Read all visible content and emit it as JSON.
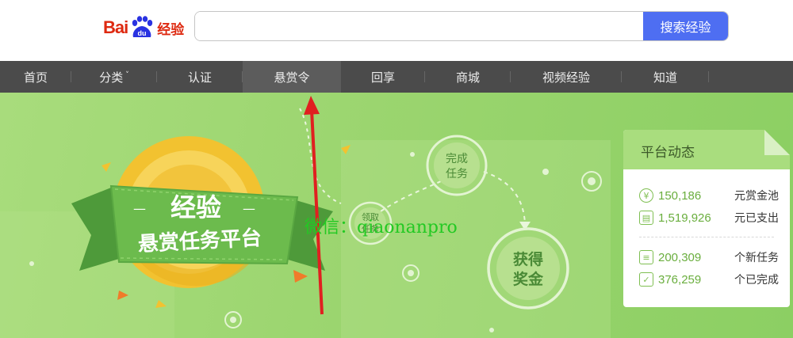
{
  "logo": {
    "bai": "Bai",
    "du": "du",
    "suffix": "经验"
  },
  "search": {
    "value": "",
    "placeholder": "",
    "button_label": "搜索经验"
  },
  "nav": {
    "items": [
      {
        "label": "首页"
      },
      {
        "label": "分类",
        "caret": "˅"
      },
      {
        "label": "认证"
      },
      {
        "label": "悬赏令",
        "active": true
      },
      {
        "label": "回享"
      },
      {
        "label": "商城"
      },
      {
        "label": "视频经验"
      },
      {
        "label": "知道"
      }
    ]
  },
  "banner": {
    "ribbon_line1": "经验",
    "ribbon_line2": "悬赏任务平台",
    "step_receive": "领取任务",
    "step_complete": "完成任务",
    "step_reward": "获得奖金",
    "step_receive_l1": "领取",
    "step_receive_l2": "任务",
    "step_complete_l1": "完成",
    "step_complete_l2": "任务",
    "step_reward_l1": "获得",
    "step_reward_l2": "奖金"
  },
  "watermark": "微信：qiaonanpro",
  "panel": {
    "title": "平台动态",
    "stats": [
      {
        "icon": "yen-icon",
        "value": "150,186",
        "unit": "元赏金池"
      },
      {
        "icon": "wallet-icon",
        "value": "1,519,926",
        "unit": "元已支出"
      },
      {
        "icon": "list-icon",
        "value": "200,309",
        "unit": "个新任务"
      },
      {
        "icon": "check-icon",
        "value": "376,259",
        "unit": "个已完成"
      }
    ]
  },
  "colors": {
    "brand_red": "#de2910",
    "brand_blue": "#2932e1",
    "search_button": "#4e6ef2",
    "nav_bg": "#4b4b4b",
    "nav_active": "#5c5c5c",
    "banner_green": "#9bd56f",
    "stat_green": "#6aae3e",
    "arrow_red": "#e02020"
  }
}
